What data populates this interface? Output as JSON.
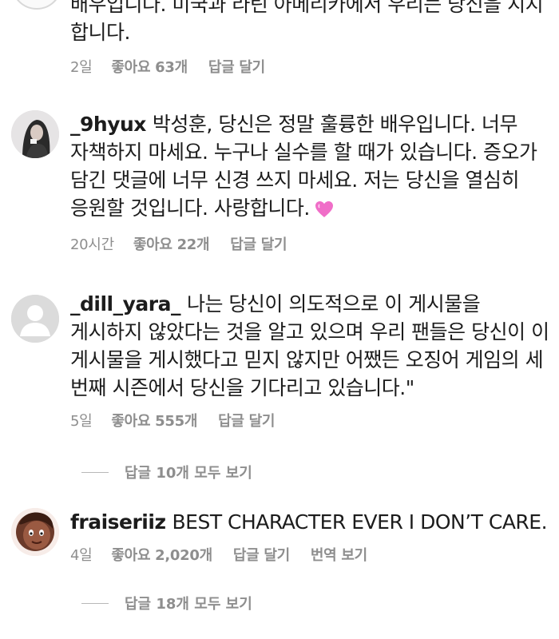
{
  "comments": [
    {
      "username": "",
      "text_lines": [
        "배우입니다. 미국과 라틴 아메리카에서 우리는 당신을 지지",
        "합니다."
      ],
      "time": "2일",
      "likes": "좋아요 63개",
      "reply": "답글 달기"
    },
    {
      "username": "_9hyux",
      "text": "박성훈, 당신은 정말 훌륭한 배우입니다. 너무 자책하지 마세요. 누구나 실수를 할 때가 있습니다. 증오가 담긴 댓글에 너무 신경 쓰지 마세요. 저는 당신을 열심히 응원할 것입니다. 사랑합니다.",
      "emoji": "pink-heart-icon",
      "time": "20시간",
      "likes": "좋아요 22개",
      "reply": "답글 달기"
    },
    {
      "username": "_dill_yara_",
      "text": "나는 당신이 의도적으로 이 게시물을 게시하지 않았다는 것을 알고 있으며 우리 팬들은 당신이 이 게시물을 게시했다고 믿지 않지만 어쨌든 오징어 게임의 세 번째 시즌에서 당신을 기다리고 있습니다.\"",
      "time": "5일",
      "likes": "좋아요 555개",
      "reply": "답글 달기",
      "view_replies": "답글 10개 모두 보기"
    },
    {
      "username": "fraiseriiz",
      "text": "BEST CHARACTER EVER I DON’T CARE.",
      "time": "4일",
      "likes": "좋아요 2,020개",
      "reply": "답글 달기",
      "translate": "번역 보기",
      "view_replies": "답글 18개 모두 보기"
    }
  ],
  "colors": {
    "text": "#1c1c1c",
    "meta": "#8e8e8e",
    "heart": "#f06ec8"
  }
}
